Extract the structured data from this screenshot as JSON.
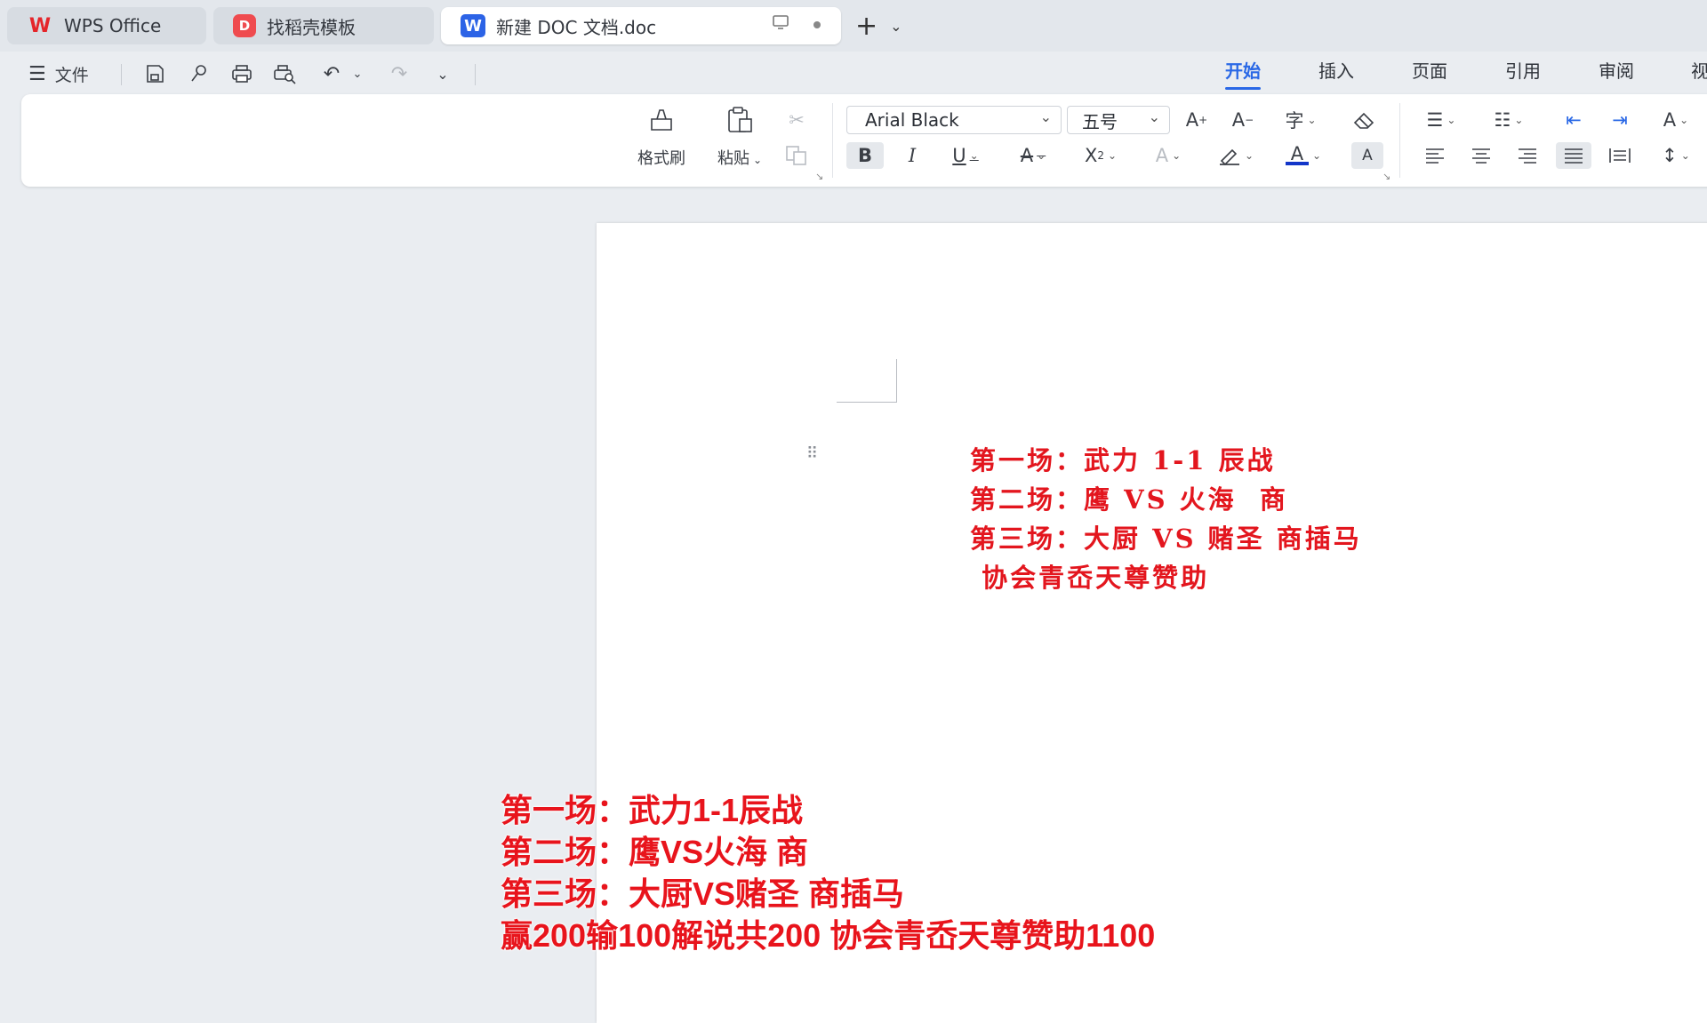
{
  "tabs": [
    {
      "label": "WPS Office",
      "icon": "wps-logo-icon"
    },
    {
      "label": "找稻壳模板",
      "icon": "docer-logo-icon"
    },
    {
      "label": "新建 DOC 文档.doc",
      "icon": "word-doc-icon",
      "active": true
    }
  ],
  "quickbar": {
    "file_label": "文件"
  },
  "menu_tabs": [
    "开始",
    "插入",
    "页面",
    "引用",
    "审阅",
    "视"
  ],
  "active_menu_tab": "开始",
  "ribbon": {
    "format_painter_label": "格式刷",
    "paste_label": "粘贴",
    "font_name": "Arial Black",
    "font_size": "五号"
  },
  "document": {
    "lines": [
      "第一场：武力 1-1 辰战",
      "第二场：鹰 VS 火海  商",
      "第三场：大厨 VS 赌圣 商插马",
      " 协会青岙天尊赞助"
    ]
  },
  "subtitles": [
    "第一场：武力1-1辰战",
    "第二场：鹰VS火海 商",
    "第三场：大厨VS赌圣 商插马",
    "赢200输100解说共200 协会青岙天尊赞助1100"
  ],
  "colors": {
    "accent": "#2a68e6",
    "doc_text": "#e3161e",
    "subtitle_text": "#e8141c",
    "background": "#eaedf1"
  }
}
